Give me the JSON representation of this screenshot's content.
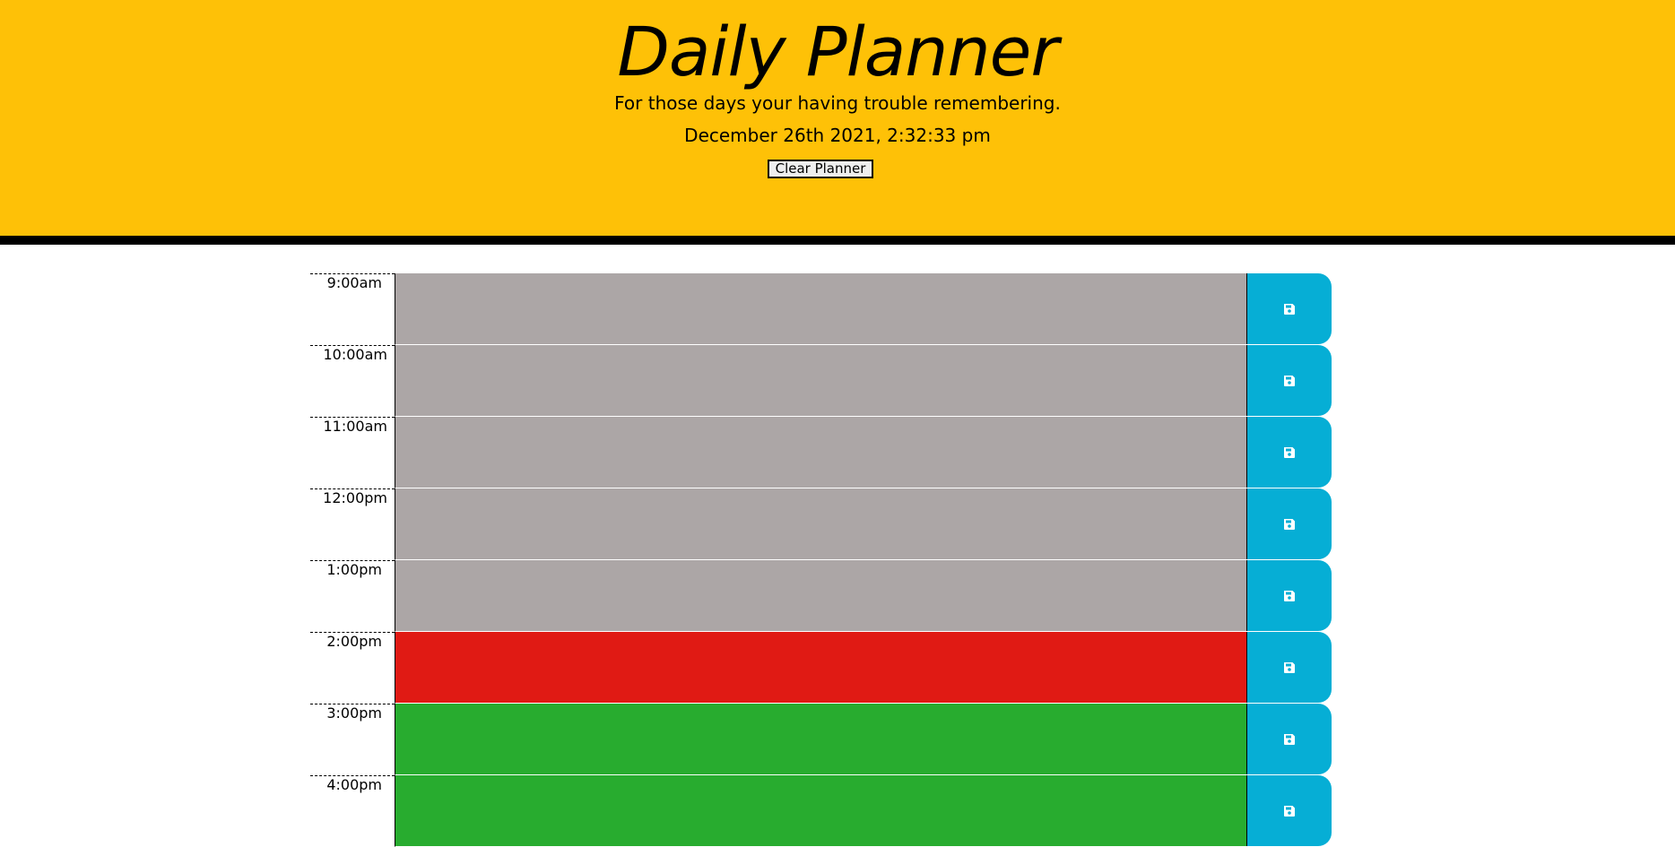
{
  "header": {
    "title": "Daily Planner",
    "subtitle": "For those days your having trouble remembering.",
    "datetime": "December 26th 2021, 2:32:33 pm",
    "clear_button": "Clear Planner"
  },
  "colors": {
    "header_bg": "#fec107",
    "past": "#aca6a6",
    "present": "#e01a14",
    "future": "#28ac2f",
    "save_button": "#06aed5"
  },
  "hours": [
    {
      "label": "9:00am",
      "status": "past",
      "value": ""
    },
    {
      "label": "10:00am",
      "status": "past",
      "value": ""
    },
    {
      "label": "11:00am",
      "status": "past",
      "value": ""
    },
    {
      "label": "12:00pm",
      "status": "past",
      "value": ""
    },
    {
      "label": "1:00pm",
      "status": "past",
      "value": ""
    },
    {
      "label": "2:00pm",
      "status": "present",
      "value": ""
    },
    {
      "label": "3:00pm",
      "status": "future",
      "value": ""
    },
    {
      "label": "4:00pm",
      "status": "future",
      "value": ""
    }
  ],
  "icons": {
    "save": "floppy-disk-icon"
  }
}
